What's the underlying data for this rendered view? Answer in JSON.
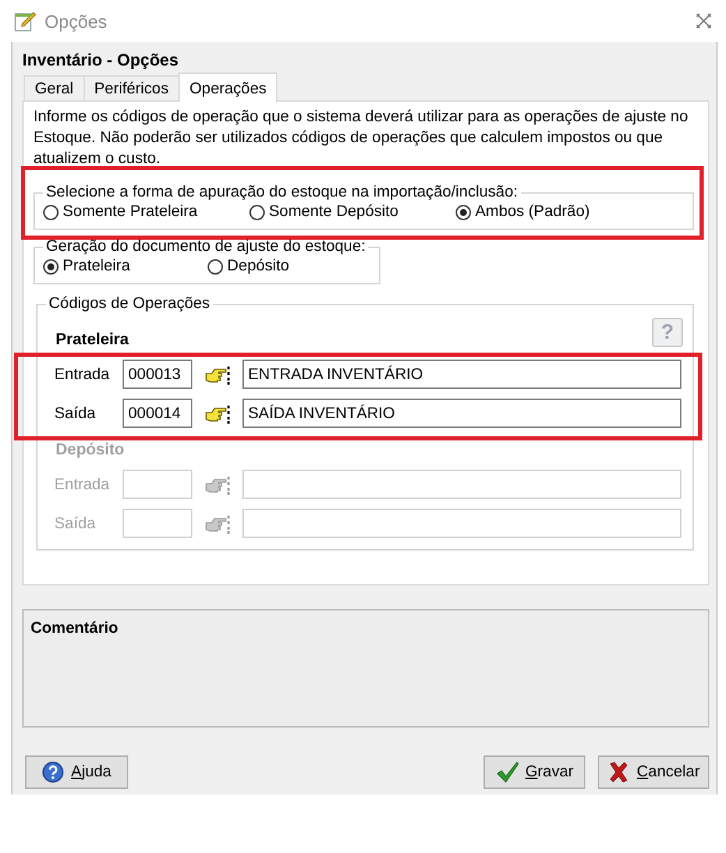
{
  "window": {
    "title": "Opções"
  },
  "header": "Inventário - Opções",
  "tabs": [
    {
      "label": "Geral",
      "selected": false
    },
    {
      "label": "Periféricos",
      "selected": false
    },
    {
      "label": "Operações",
      "selected": true
    }
  ],
  "description": "Informe os códigos de operação que o sistema deverá utilizar para as operações de ajuste no Estoque. Não poderão ser utilizados códigos de operações que calculem impostos ou que atualizem o custo.",
  "groups": [
    {
      "legend": "Selecione a forma de apuração do estoque na importação/inclusão:",
      "highlighted": true,
      "options": [
        {
          "label": "Somente Prateleira",
          "selected": false
        },
        {
          "label": "Somente Depósito",
          "selected": false
        },
        {
          "label": "Ambos (Padrão)",
          "selected": true
        }
      ]
    },
    {
      "legend": "Geração do documento de ajuste do estoque:",
      "highlighted": false,
      "options": [
        {
          "label": "Prateleira",
          "selected": true
        },
        {
          "label": "Depósito",
          "selected": false
        }
      ]
    }
  ],
  "codes": {
    "legend": "Códigos de Operações",
    "help_label": "?",
    "sections": [
      {
        "title": "Prateleira",
        "disabled": false,
        "highlighted": true,
        "rows": [
          {
            "label": "Entrada",
            "code": "000013",
            "description": "ENTRADA INVENTÁRIO"
          },
          {
            "label": "Saída",
            "code": "000014",
            "description": "SAÍDA INVENTÁRIO"
          }
        ]
      },
      {
        "title": "Depósito",
        "disabled": true,
        "highlighted": false,
        "rows": [
          {
            "label": "Entrada"
          },
          {
            "label": "Saída"
          }
        ]
      }
    ]
  },
  "comment": {
    "title": "Comentário"
  },
  "buttons": [
    {
      "label": "Ajuda",
      "kind": "help"
    },
    {
      "label": "Gravar",
      "kind": "save"
    },
    {
      "label": "Cancelar",
      "kind": "cancel"
    }
  ]
}
